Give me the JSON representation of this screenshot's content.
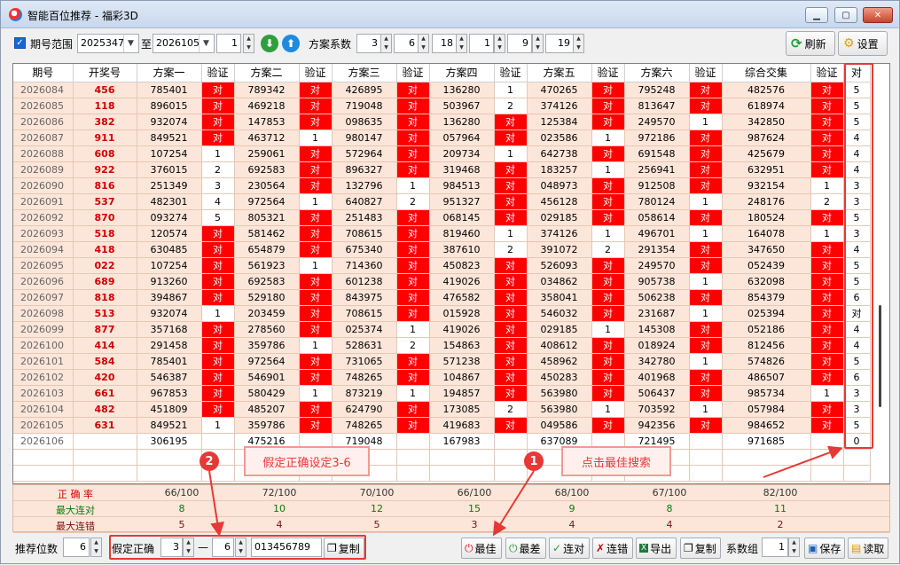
{
  "window": {
    "title": "智能百位推荐 - 福彩3D",
    "minimize": "▁",
    "maximize": "▢",
    "close": "✕"
  },
  "toolbar": {
    "range_label": "期号范围",
    "from": "2025347",
    "to_label": "至",
    "to": "2026105",
    "step": "1",
    "scheme_label": "方案系数",
    "coeffs": [
      "3",
      "6",
      "18",
      "1",
      "9",
      "19"
    ],
    "refresh": "刷新",
    "settings": "设置"
  },
  "table": {
    "headers": [
      "期号",
      "开奖号",
      "方案一",
      "验证",
      "方案二",
      "验证",
      "方案三",
      "验证",
      "方案四",
      "验证",
      "方案五",
      "验证",
      "方案六",
      "验证",
      "综合交集",
      "验证",
      "对"
    ],
    "rows": [
      [
        "2026084",
        "456",
        "785401",
        "对",
        "789342",
        "对",
        "426895",
        "对",
        "136280",
        "1",
        "470265",
        "对",
        "795248",
        "对",
        "482576",
        "对",
        "5"
      ],
      [
        "2026085",
        "118",
        "896015",
        "对",
        "469218",
        "对",
        "719048",
        "对",
        "503967",
        "2",
        "374126",
        "对",
        "813647",
        "对",
        "618974",
        "对",
        "5"
      ],
      [
        "2026086",
        "382",
        "932074",
        "对",
        "147853",
        "对",
        "098635",
        "对",
        "136280",
        "对",
        "125384",
        "对",
        "249570",
        "1",
        "342850",
        "对",
        "5"
      ],
      [
        "2026087",
        "911",
        "849521",
        "对",
        "463712",
        "1",
        "980147",
        "对",
        "057964",
        "对",
        "023586",
        "1",
        "972186",
        "对",
        "987624",
        "对",
        "4"
      ],
      [
        "2026088",
        "608",
        "107254",
        "1",
        "259061",
        "对",
        "572964",
        "对",
        "209734",
        "1",
        "642738",
        "对",
        "691548",
        "对",
        "425679",
        "对",
        "4"
      ],
      [
        "2026089",
        "922",
        "376015",
        "2",
        "692583",
        "对",
        "896327",
        "对",
        "319468",
        "对",
        "183257",
        "1",
        "256941",
        "对",
        "632951",
        "对",
        "4"
      ],
      [
        "2026090",
        "816",
        "251349",
        "3",
        "230564",
        "对",
        "132796",
        "1",
        "984513",
        "对",
        "048973",
        "对",
        "912508",
        "对",
        "932154",
        "1",
        "3"
      ],
      [
        "2026091",
        "537",
        "482301",
        "4",
        "972564",
        "1",
        "640827",
        "2",
        "951327",
        "对",
        "456128",
        "对",
        "780124",
        "1",
        "248176",
        "2",
        "3"
      ],
      [
        "2026092",
        "870",
        "093274",
        "5",
        "805321",
        "对",
        "251483",
        "对",
        "068145",
        "对",
        "029185",
        "对",
        "058614",
        "对",
        "180524",
        "对",
        "5"
      ],
      [
        "2026093",
        "518",
        "120574",
        "对",
        "581462",
        "对",
        "708615",
        "对",
        "819460",
        "1",
        "374126",
        "1",
        "496701",
        "1",
        "164078",
        "1",
        "3"
      ],
      [
        "2026094",
        "418",
        "630485",
        "对",
        "654879",
        "对",
        "675340",
        "对",
        "387610",
        "2",
        "391072",
        "2",
        "291354",
        "对",
        "347650",
        "对",
        "4"
      ],
      [
        "2026095",
        "022",
        "107254",
        "对",
        "561923",
        "1",
        "714360",
        "对",
        "450823",
        "对",
        "526093",
        "对",
        "249570",
        "对",
        "052439",
        "对",
        "5"
      ],
      [
        "2026096",
        "689",
        "913260",
        "对",
        "692583",
        "对",
        "601238",
        "对",
        "419026",
        "对",
        "034862",
        "对",
        "905738",
        "1",
        "632098",
        "对",
        "5"
      ],
      [
        "2026097",
        "818",
        "394867",
        "对",
        "529180",
        "对",
        "843975",
        "对",
        "476582",
        "对",
        "358041",
        "对",
        "506238",
        "对",
        "854379",
        "对",
        "6"
      ],
      [
        "2026098",
        "513",
        "932074",
        "1",
        "203459",
        "对",
        "708615",
        "对",
        "015928",
        "对",
        "546032",
        "对",
        "231687",
        "1",
        "025394",
        "对",
        "对"
      ],
      [
        "2026099",
        "877",
        "357168",
        "对",
        "278560",
        "对",
        "025374",
        "1",
        "419026",
        "对",
        "029185",
        "1",
        "145308",
        "对",
        "052186",
        "对",
        "4"
      ],
      [
        "2026100",
        "414",
        "291458",
        "对",
        "359786",
        "1",
        "528631",
        "2",
        "154863",
        "对",
        "408612",
        "对",
        "018924",
        "对",
        "812456",
        "对",
        "4"
      ],
      [
        "2026101",
        "584",
        "785401",
        "对",
        "972564",
        "对",
        "731065",
        "对",
        "571238",
        "对",
        "458962",
        "对",
        "342780",
        "1",
        "574826",
        "对",
        "5"
      ],
      [
        "2026102",
        "420",
        "546387",
        "对",
        "546901",
        "对",
        "748265",
        "对",
        "104867",
        "对",
        "450283",
        "对",
        "401968",
        "对",
        "486507",
        "对",
        "6"
      ],
      [
        "2026103",
        "661",
        "967853",
        "对",
        "580429",
        "1",
        "873219",
        "1",
        "194857",
        "对",
        "563980",
        "对",
        "506437",
        "对",
        "985734",
        "1",
        "3"
      ],
      [
        "2026104",
        "482",
        "451809",
        "对",
        "485207",
        "对",
        "624790",
        "对",
        "173085",
        "2",
        "563980",
        "1",
        "703592",
        "1",
        "057984",
        "对",
        "3"
      ],
      [
        "2026105",
        "631",
        "849521",
        "1",
        "359786",
        "对",
        "748265",
        "对",
        "419683",
        "对",
        "049586",
        "对",
        "942356",
        "对",
        "984652",
        "对",
        "5"
      ]
    ],
    "pending": [
      "2026106",
      "",
      "306195",
      "",
      "475216",
      "",
      "719048",
      "",
      "167983",
      "",
      "637089",
      "",
      "721495",
      "",
      "971685",
      "",
      "0"
    ]
  },
  "stats": {
    "accuracy_label": "正 确 率",
    "accuracy": [
      "66/100",
      "72/100",
      "70/100",
      "66/100",
      "68/100",
      "67/100",
      "82/100"
    ],
    "max_hit_label": "最大连对",
    "max_hit": [
      "8",
      "10",
      "12",
      "15",
      "9",
      "8",
      "11"
    ],
    "max_miss_label": "最大连错",
    "max_miss": [
      "5",
      "4",
      "5",
      "3",
      "4",
      "4",
      "2"
    ]
  },
  "bottom": {
    "digits_label": "推荐位数",
    "digits": "6",
    "assume_label": "假定正确",
    "assume_from": "3",
    "dash": "—",
    "assume_to": "6",
    "code": "013456789",
    "copy": "复制",
    "best": "最佳",
    "worst": "最差",
    "hit": "连对",
    "miss": "连错",
    "export": "导出",
    "copy2": "复制",
    "coef_group_label": "系数组",
    "coef_group": "1",
    "save": "保存",
    "read": "读取"
  },
  "annotations": {
    "num1": "1",
    "label1": "点击最佳搜索",
    "num2": "2",
    "label2": "假定正确设定3-6"
  },
  "colors": {
    "hit": "#ff0000",
    "annotation": "#e53935"
  }
}
